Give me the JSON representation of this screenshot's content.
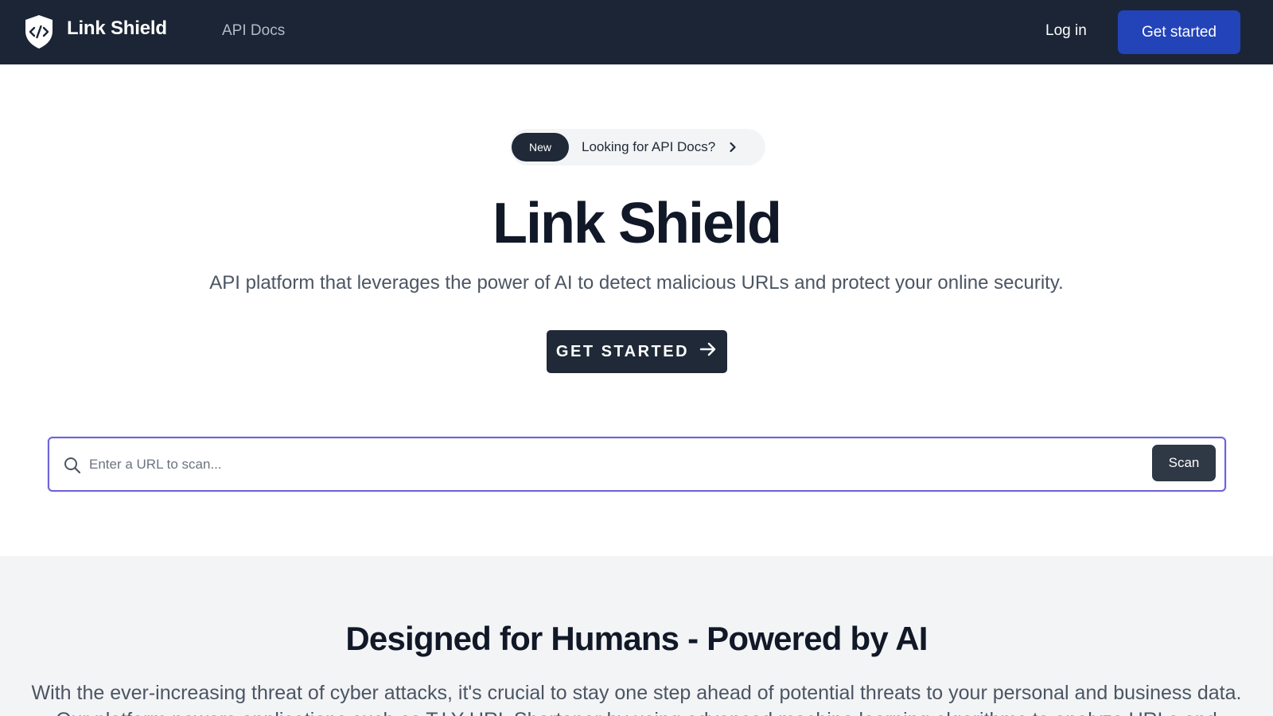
{
  "nav": {
    "brand": "Link Shield",
    "links": [
      "API Docs"
    ],
    "login": "Log in",
    "cta": "Get started"
  },
  "hero": {
    "badge": "New",
    "announcement": "Looking for API Docs?",
    "title": "Link Shield",
    "subtitle": "API platform that leverages the power of AI to detect malicious URLs and protect your online security.",
    "button": "GET STARTED"
  },
  "search": {
    "placeholder": "Enter a URL to scan...",
    "value": "",
    "button": "Scan"
  },
  "features": {
    "title": "Designed for Humans - Powered by AI",
    "text": "With the ever-increasing threat of cyber attacks, it's crucial to stay one step ahead of potential threats to your personal and business data. Our platform powers applications such as T.LY URL Shortener by using advanced machine learning algorithms to analyze URLs and"
  },
  "colors": {
    "nav_bg": "#1b2535",
    "primary": "#2343b8",
    "dark_button": "#1f2937",
    "focus_ring": "#6d63d8",
    "section_bg": "#f3f4f6"
  },
  "icons": {
    "brand": "shield-code-icon",
    "announcement": "chevron-right-icon",
    "hero_button": "arrow-right-icon",
    "search": "search-icon"
  }
}
